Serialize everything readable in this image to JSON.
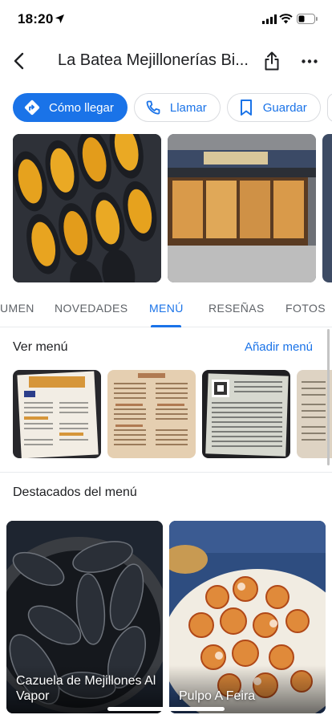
{
  "status": {
    "time": "18:20"
  },
  "header": {
    "title": "La Batea Mejillonerías Bi..."
  },
  "icons": {
    "location": "location-arrow-icon",
    "signal": "cellular-signal-icon",
    "wifi": "wifi-icon",
    "battery": "battery-icon",
    "back": "back-arrow-icon",
    "share": "share-icon",
    "more": "more-horizontal-icon",
    "directions": "directions-icon",
    "call": "phone-icon",
    "save": "bookmark-icon"
  },
  "actions": {
    "directions": "Cómo llegar",
    "call": "Llamar",
    "save": "Guardar"
  },
  "tabs": [
    {
      "label": "UMEN"
    },
    {
      "label": "NOVEDADES"
    },
    {
      "label": "MENÚ"
    },
    {
      "label": "RESEÑAS"
    },
    {
      "label": "FOTOS"
    }
  ],
  "menu": {
    "title": "Ver menú",
    "add": "Añadir menú"
  },
  "featured": {
    "title": "Destacados del menú",
    "items": [
      {
        "name": "Cazuela de Mejillones Al Vapor"
      },
      {
        "name": "Pulpo A Feira"
      }
    ]
  },
  "colors": {
    "accent": "#1a73e8",
    "text": "#202124",
    "muted": "#5f6368",
    "border": "#dadce0"
  }
}
